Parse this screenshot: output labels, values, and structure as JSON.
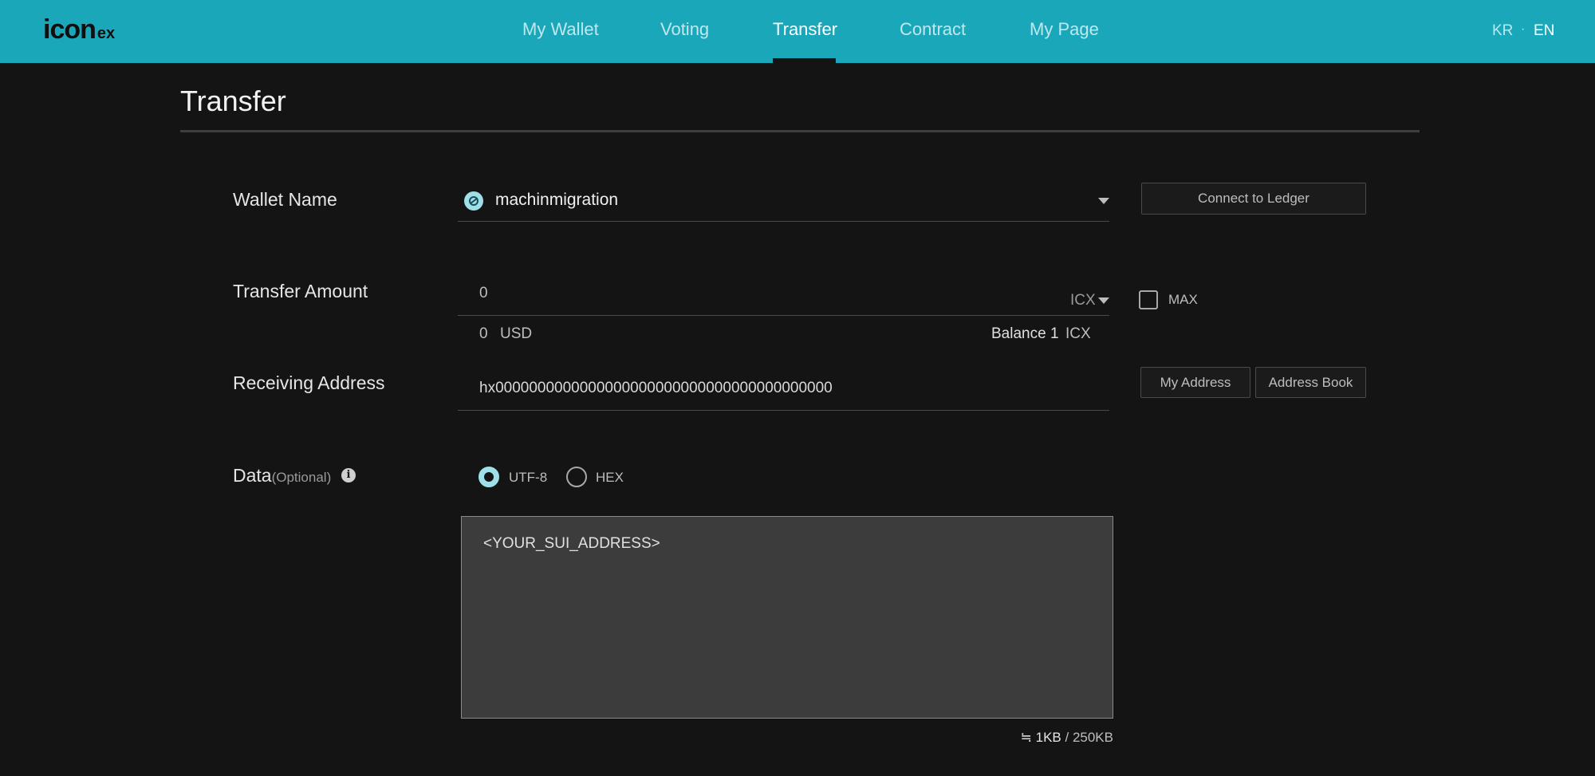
{
  "brand": {
    "logo_main": "icon",
    "logo_suffix": "ex"
  },
  "nav": {
    "items": [
      "My Wallet",
      "Voting",
      "Transfer",
      "Contract",
      "My Page"
    ],
    "active": "Transfer"
  },
  "lang": {
    "kr": "KR",
    "separator": "·",
    "en": "EN",
    "active": "EN"
  },
  "page": {
    "title": "Transfer"
  },
  "form": {
    "wallet": {
      "label": "Wallet Name",
      "value": "machinmigration",
      "connect_button": "Connect to Ledger"
    },
    "amount": {
      "label": "Transfer Amount",
      "value": "0",
      "unit": "ICX",
      "max_label": "MAX",
      "usd_value": "0",
      "usd_unit": "USD",
      "balance_label": "Balance",
      "balance_value": "1",
      "balance_unit": "ICX"
    },
    "address": {
      "label": "Receiving Address",
      "value": "hx0000000000000000000000000000000000000000",
      "my_address_button": "My Address",
      "address_book_button": "Address Book"
    },
    "data": {
      "label": "Data",
      "optional": "(Optional)",
      "encoding_options": [
        "UTF-8",
        "HEX"
      ],
      "selected_encoding": "UTF-8",
      "content": "<YOUR_SUI_ADDRESS>",
      "size_current": "≒ 1KB",
      "size_limit": "/ 250KB"
    }
  },
  "colors": {
    "accent": "#1aa7ba",
    "background": "#141414",
    "input_box": "#3c3c3c",
    "radio_active": "#9fdfea"
  },
  "icons": {
    "wallet": "icon-coin-icon",
    "dropdown": "caret-down-icon",
    "info": "info-icon"
  }
}
